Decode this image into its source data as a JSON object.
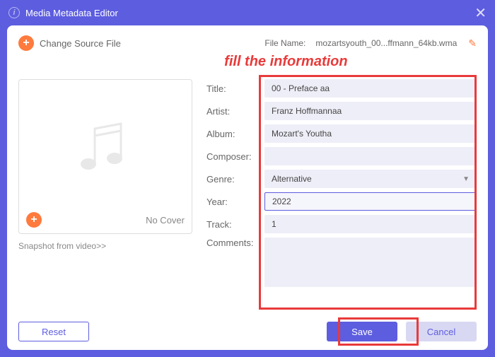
{
  "window": {
    "title": "Media Metadata Editor"
  },
  "header": {
    "change_source": "Change Source File",
    "filename_label": "File Name:",
    "filename_value": "mozartsyouth_00...ffmann_64kb.wma"
  },
  "annotation": "fill the information",
  "cover": {
    "no_cover": "No Cover",
    "snapshot_link": "Snapshot from video>>"
  },
  "form": {
    "title": {
      "label": "Title:",
      "value": "00 - Preface aa"
    },
    "artist": {
      "label": "Artist:",
      "value": "Franz Hoffmannaa"
    },
    "album": {
      "label": "Album:",
      "value": "Mozart's Youtha"
    },
    "composer": {
      "label": "Composer:",
      "value": ""
    },
    "genre": {
      "label": "Genre:",
      "value": "Alternative"
    },
    "year": {
      "label": "Year:",
      "value": "2022"
    },
    "track": {
      "label": "Track:",
      "value": "1"
    },
    "comments": {
      "label": "Comments:",
      "value": ""
    }
  },
  "buttons": {
    "reset": "Reset",
    "save": "Save",
    "cancel": "Cancel"
  }
}
